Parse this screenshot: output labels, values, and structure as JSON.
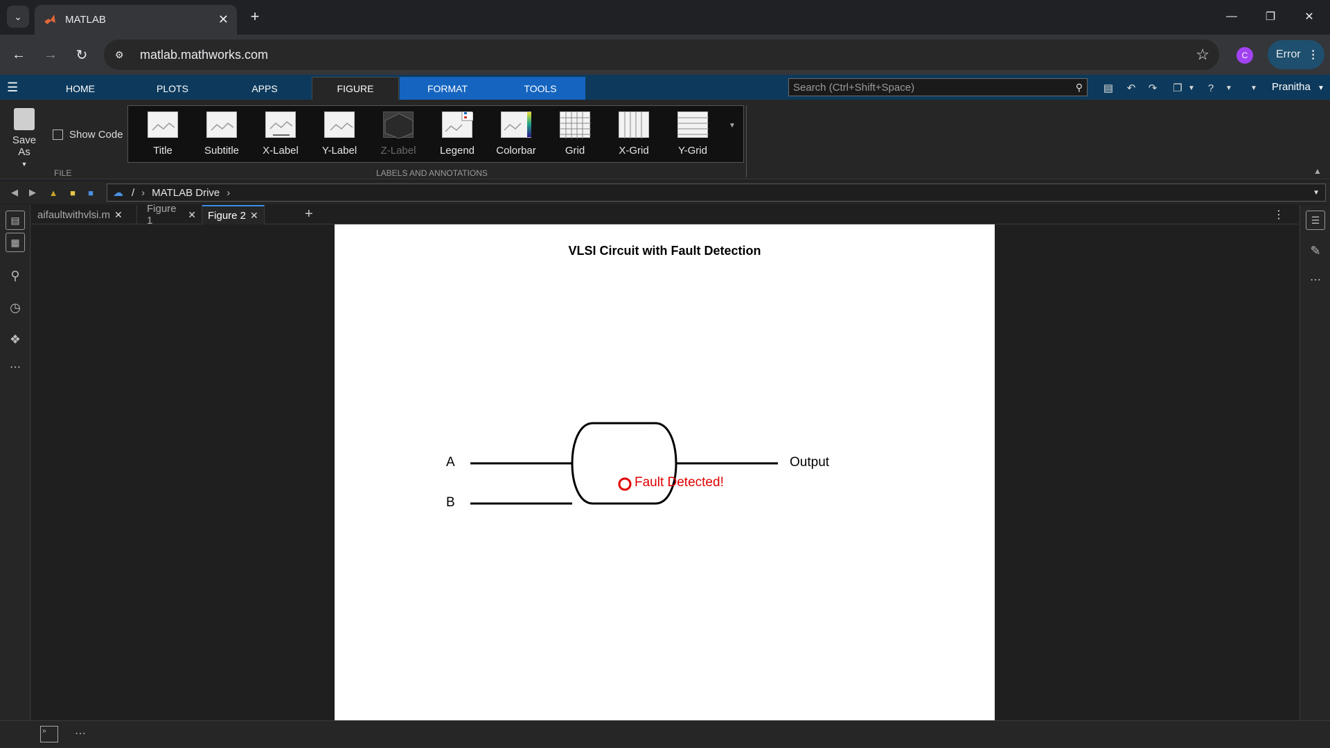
{
  "browser": {
    "tab_title": "MATLAB",
    "url": "matlab.mathworks.com",
    "profile_initial": "C",
    "error_label": "Error",
    "accent": "#1e4f6e"
  },
  "matlab": {
    "tabs": [
      {
        "label": "HOME"
      },
      {
        "label": "PLOTS"
      },
      {
        "label": "APPS"
      },
      {
        "label": "FIGURE"
      },
      {
        "label": "FORMAT"
      },
      {
        "label": "TOOLS"
      }
    ],
    "search_placeholder": "Search (Ctrl+Shift+Space)",
    "user_name": "Pranitha"
  },
  "ribbon": {
    "save_as": "Save As",
    "show_code": "Show Code",
    "file_section": "FILE",
    "labels_section": "LABELS AND ANNOTATIONS",
    "gallery": [
      {
        "label": "Title",
        "icon": "title-icon"
      },
      {
        "label": "Subtitle",
        "icon": "subtitle-icon"
      },
      {
        "label": "X-Label",
        "icon": "xlabel-icon"
      },
      {
        "label": "Y-Label",
        "icon": "ylabel-icon"
      },
      {
        "label": "Z-Label",
        "icon": "zlabel-icon",
        "disabled": true
      },
      {
        "label": "Legend",
        "icon": "legend-icon"
      },
      {
        "label": "Colorbar",
        "icon": "colorbar-icon"
      },
      {
        "label": "Grid",
        "icon": "grid-icon"
      },
      {
        "label": "X-Grid",
        "icon": "xgrid-icon"
      },
      {
        "label": "Y-Grid",
        "icon": "ygrid-icon"
      }
    ]
  },
  "address": {
    "root": "/",
    "folder": "MATLAB Drive"
  },
  "doc_tabs": [
    {
      "label": "aifaultwithvlsi.m"
    },
    {
      "label": "Figure 1"
    },
    {
      "label": "Figure 2",
      "active": true
    }
  ],
  "figure": {
    "title": "VLSI Circuit with Fault Detection",
    "input_a": "A",
    "input_b": "B",
    "output": "Output",
    "fault_text": "Fault Detected!",
    "fault_color": "#e00000"
  }
}
